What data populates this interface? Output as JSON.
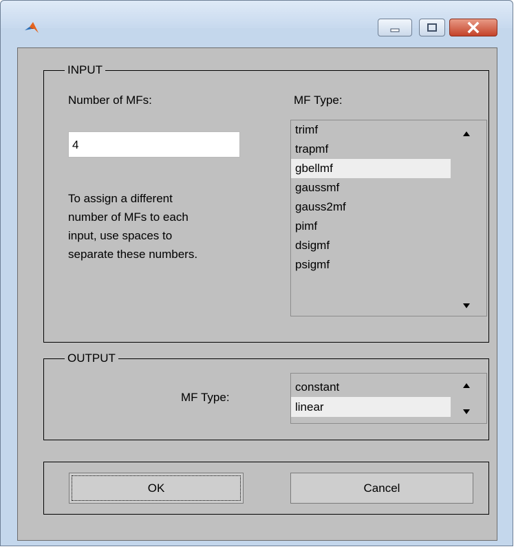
{
  "window": {
    "icon": "matlab-logo-icon",
    "controls": [
      "minimize-icon",
      "maximize-icon",
      "close-icon"
    ]
  },
  "input": {
    "legend": "INPUT",
    "num_mfs_label": "Number of MFs:",
    "num_mfs_value": "4",
    "help_text": "To assign a different\nnumber of MFs to each\ninput, use spaces to\nseparate these numbers.",
    "mf_type_label": "MF Type:",
    "mf_types": [
      "trimf",
      "trapmf",
      "gbellmf",
      "gaussmf",
      "gauss2mf",
      "pimf",
      "dsigmf",
      "psigmf"
    ],
    "selected": "gbellmf"
  },
  "output": {
    "legend": "OUTPUT",
    "mf_type_label": "MF Type:",
    "mf_types": [
      "constant",
      "linear"
    ],
    "selected": "linear"
  },
  "buttons": {
    "ok": "OK",
    "cancel": "Cancel"
  },
  "colors": {
    "panel": "#c0c0c0",
    "selection": "#eeeeee",
    "title_bar": "#c4d7ec",
    "close_button": "#c4432a"
  }
}
